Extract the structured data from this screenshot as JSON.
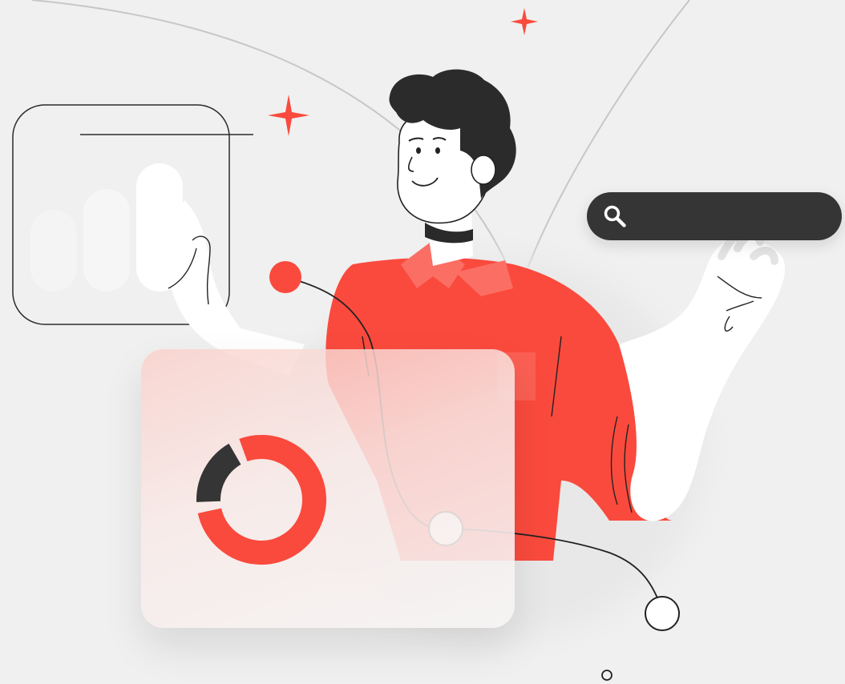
{
  "illustration": {
    "colors": {
      "background": "#f0f0f0",
      "accent": "#fa4a3d",
      "dark": "#353535",
      "outline": "#222222",
      "glass": "#f6eceb"
    },
    "icons": [
      "sparkle-icon",
      "search-icon",
      "bar-chart-icon",
      "donut-chart-icon"
    ]
  },
  "search": {
    "value": "",
    "placeholder": ""
  },
  "donut_chart": {
    "segments": [
      {
        "color": "#fa4a3d",
        "fraction": 0.8
      },
      {
        "color": "#353535",
        "fraction": 0.2
      }
    ]
  },
  "bar_chart": {
    "bars": 3
  }
}
